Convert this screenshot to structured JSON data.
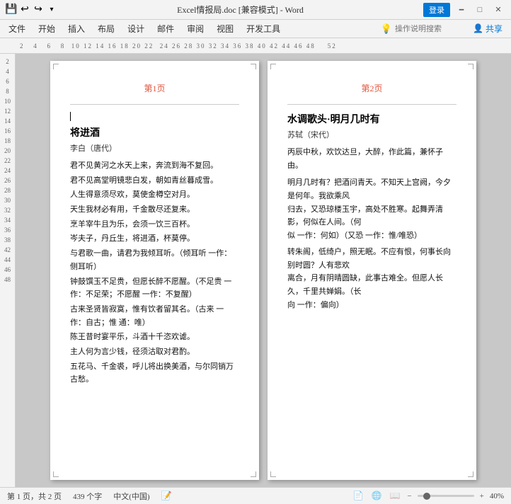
{
  "titlebar": {
    "filename": "Excel情报局.doc [兼容模式] - Word",
    "login_btn": "登录",
    "quick_save": "💾",
    "quick_undo": "↩",
    "quick_redo": "↪",
    "quick_custom": "🔧"
  },
  "menubar": {
    "items": [
      "文件",
      "开始",
      "插入",
      "布局",
      "设计",
      "邮件",
      "审阅",
      "视图",
      "开发工具"
    ],
    "search_placeholder": "操作说明搜索",
    "share_label": "共享"
  },
  "ruler": {
    "numbers": "2  4  6  8  10 12 14 16 18 20 22  24 26 28 30 32 34 36 38 40 42 44 46 48   52"
  },
  "side_ruler": {
    "numbers": [
      "2",
      "4",
      "6",
      "8",
      "10",
      "12",
      "14",
      "16",
      "18",
      "20",
      "22",
      "24",
      "26",
      "28",
      "30",
      "32",
      "34",
      "36",
      "38",
      "42",
      "44",
      "46",
      "48"
    ]
  },
  "page1": {
    "label": "第1页",
    "title": "将进酒",
    "subtitle": "李白（唐代）",
    "hr": true,
    "body": [
      "君不见黄河之水天上来，奔流到海不复回。",
      "君不见高堂明镜悲白发，朝如青丝暮成雪。",
      "人生得意须尽欢，莫使金樽空对月。",
      "天生我材必有用，千金散尽还复来。",
      "烹羊宰牛且为乐，会须一饮三百杯。",
      "岑夫子，丹丘生，将进酒，杯莫停。",
      "与君歌一曲，请君为我倾耳听。（倾耳听 一作：侧耳听）",
      "钟鼓馔玉不足贵，但愿长醉不愿醒。（不足贵 一作：不足荣；不愿醒 一作：不复醒）",
      "古来圣贤皆寂寞，惟有饮者留其名。（古来 一作：自古；惟 通：唯）",
      "陈王昔时宴平乐，斗酒十千恣欢谑。",
      "主人何为言少钱，径须沽取对君酌。",
      "五花马、千金裘，呼儿将出换美酒，与尔同销万古愁。"
    ]
  },
  "page2": {
    "label": "第2页",
    "title": "水调歌头·明月几时有",
    "subtitle": "苏轼（宋代）",
    "body_lines": [
      "丙辰中秋，欢饮达旦，大醉，作此篇，兼怀子由。",
      "明月几时有？把酒问青天。不知天上宫阙，今夕是何年。我欲乘风归去，又恐琼楼玉宇，高处不胜寒。起舞弄清影，何似在人间。（何似 一作：何如）（又恐 一作：惟/唯恐）",
      "转朱阁，低绮户，照无眠。不应有恨，何事长向别时圆？人有悲欢离合，月有阴晴圆缺，此事古难全。但愿人长久，千里共婵娟。（长向 一作：偏向）"
    ]
  },
  "statusbar": {
    "page_info": "第 1 页，共 2 页",
    "word_count": "439 个字",
    "language": "中文(中国)",
    "zoom": "40%",
    "view_icons": [
      "📄",
      "📋",
      "📖"
    ]
  },
  "colors": {
    "accent": "#e0543c",
    "link": "#0078d7",
    "border": "#d0d0d0",
    "bg": "#f3f3f3",
    "doc_bg": "#c8c8c8"
  }
}
